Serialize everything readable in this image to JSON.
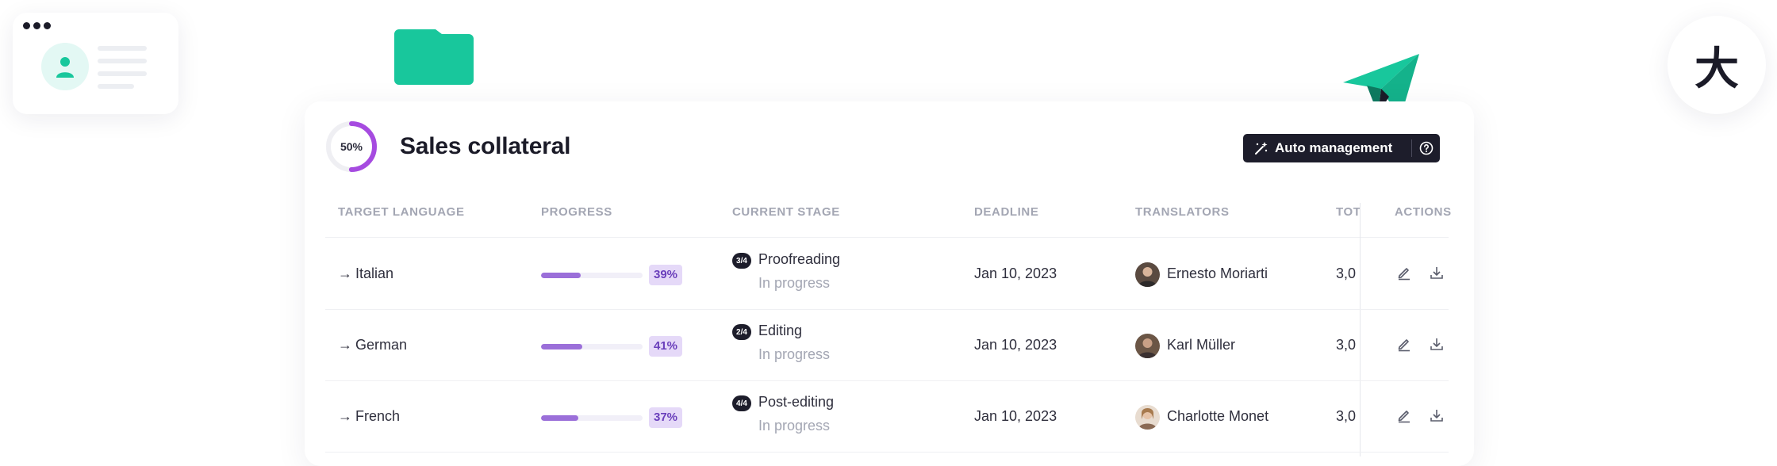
{
  "project": {
    "title": "Sales collateral",
    "progress_label": "50%",
    "progress_value": 0.5
  },
  "toolbar": {
    "auto_management_label": "Auto management"
  },
  "table": {
    "columns": [
      "TARGET LANGUAGE",
      "PROGRESS",
      "CURRENT STAGE",
      "DEADLINE",
      "TRANSLATORS",
      "TOT",
      "ACTIONS"
    ],
    "rows": [
      {
        "language": "Italian",
        "progress": 0.39,
        "progress_label": "39%",
        "stage_step": "3/4",
        "stage": "Proofreading",
        "status": "In progress",
        "deadline": "Jan 10, 2023",
        "translator": "Ernesto Moriarti",
        "total": "3,0"
      },
      {
        "language": "German",
        "progress": 0.41,
        "progress_label": "41%",
        "stage_step": "2/4",
        "stage": "Editing",
        "status": "In progress",
        "deadline": "Jan 10, 2023",
        "translator": "Karl Müller",
        "total": "3,0"
      },
      {
        "language": "French",
        "progress": 0.37,
        "progress_label": "37%",
        "stage_step": "4/4",
        "stage": "Post-editing",
        "status": "In progress",
        "deadline": "Jan 10, 2023",
        "translator": "Charlotte Monet",
        "total": "3,0"
      }
    ]
  },
  "decorations": {
    "kanji": "大",
    "icons": [
      "user-card-icon",
      "folder-icon",
      "paper-plane-icon"
    ]
  },
  "colors": {
    "brand_green": "#18c79c",
    "progress_purple": "#9b6fd9",
    "dark_button": "#1d1d2b"
  }
}
